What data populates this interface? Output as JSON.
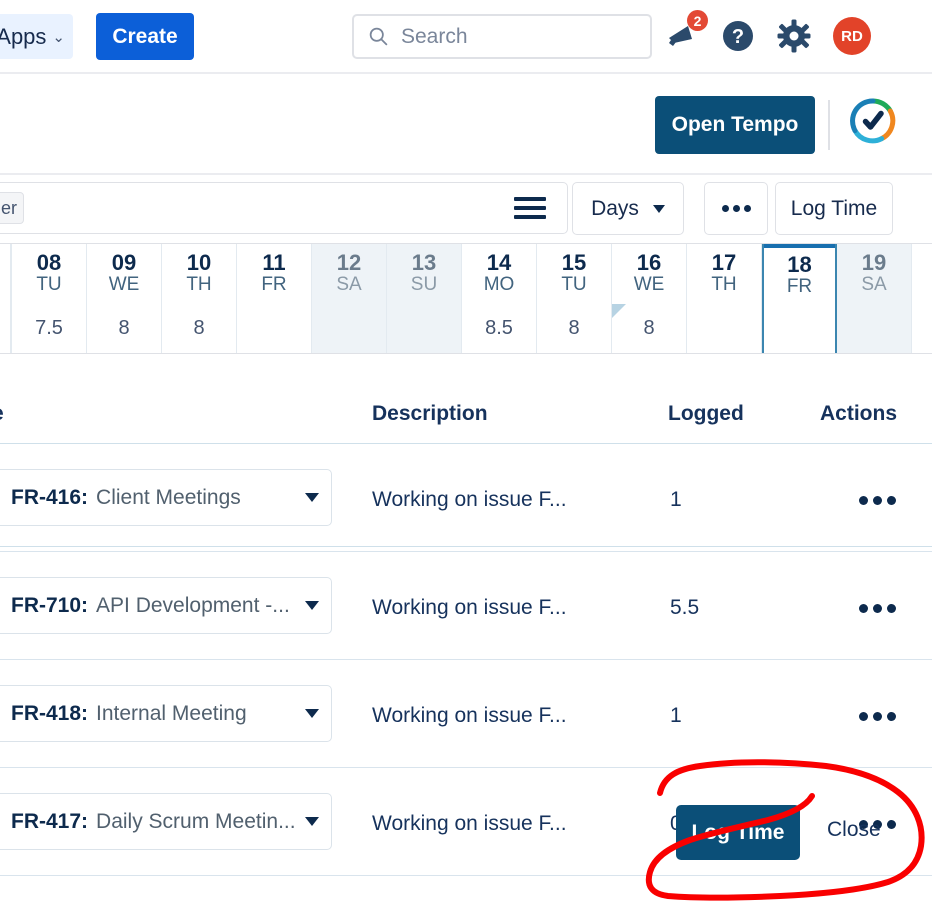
{
  "topnav": {
    "apps_label": "Apps",
    "apps_chevron": "chevron-down-icon",
    "create_label": "Create",
    "search_placeholder": "Search",
    "search_value": "",
    "notifications_badge": "2",
    "avatar_initials": "RD",
    "icons": [
      "megaphone-icon",
      "help-icon",
      "gear-icon",
      "avatar"
    ]
  },
  "tempo_header": {
    "open_tempo_label": "Open Tempo",
    "logo_name": "tempo-logo-icon"
  },
  "toolbar": {
    "filter_label": "er",
    "list_view_icon": "hamburger-icon",
    "period_label": "Days",
    "more_label": "•••",
    "log_time_label": "Log Time"
  },
  "calendar": {
    "days": [
      {
        "num": "08",
        "dow": "TU",
        "hours": "7.5",
        "weekend": false,
        "selected": false
      },
      {
        "num": "09",
        "dow": "WE",
        "hours": "8",
        "weekend": false,
        "selected": false
      },
      {
        "num": "10",
        "dow": "TH",
        "hours": "8",
        "weekend": false,
        "selected": false
      },
      {
        "num": "11",
        "dow": "FR",
        "hours": "",
        "weekend": false,
        "selected": false
      },
      {
        "num": "12",
        "dow": "SA",
        "hours": "",
        "weekend": true,
        "selected": false
      },
      {
        "num": "13",
        "dow": "SU",
        "hours": "",
        "weekend": true,
        "selected": false
      },
      {
        "num": "14",
        "dow": "MO",
        "hours": "8.5",
        "weekend": false,
        "selected": false
      },
      {
        "num": "15",
        "dow": "TU",
        "hours": "8",
        "weekend": false,
        "selected": false
      },
      {
        "num": "16",
        "dow": "WE",
        "hours": "8",
        "weekend": false,
        "selected": false
      },
      {
        "num": "17",
        "dow": "TH",
        "hours": "",
        "weekend": false,
        "selected": false
      },
      {
        "num": "18",
        "dow": "FR",
        "hours": "",
        "weekend": false,
        "selected": true
      },
      {
        "num": "19",
        "dow": "SA",
        "hours": "",
        "weekend": true,
        "selected": false
      }
    ]
  },
  "table": {
    "headers": {
      "issue": "e",
      "description": "Description",
      "logged": "Logged",
      "actions": "Actions"
    },
    "rows": [
      {
        "issue_key": "FR-416:",
        "issue_summary": "Client Meetings",
        "description": "Working on issue F...",
        "logged": "1",
        "actions": "•••"
      },
      {
        "issue_key": "FR-710:",
        "issue_summary": "API Development -...",
        "description": "Working on issue F...",
        "logged": "5.5",
        "actions": "•••"
      },
      {
        "issue_key": "FR-418:",
        "issue_summary": "Internal Meeting",
        "description": "Working on issue F...",
        "logged": "1",
        "actions": "•••"
      },
      {
        "issue_key": "FR-417:",
        "issue_summary": "Daily Scrum Meetin...",
        "description": "Working on issue F...",
        "logged": "0.5",
        "actions": "•••",
        "log_time_label": "Log Time",
        "close_label": "Close"
      }
    ]
  },
  "colors": {
    "jira_blue": "#0c5fd8",
    "tempo_navy": "#0b4f78",
    "text_navy": "#16325c",
    "avatar_red": "#e24329",
    "badge_red": "#e34935",
    "weekend_bg": "#eef3f7",
    "annotation_red": "#f90000"
  }
}
